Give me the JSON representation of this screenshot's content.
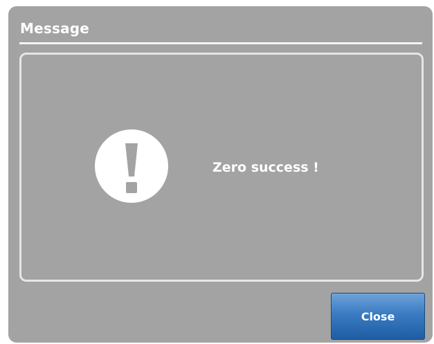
{
  "dialog": {
    "title": "Message",
    "message": "Zero success !",
    "icon": "exclamation-circle-icon",
    "close_label": "Close"
  },
  "colors": {
    "dialog_background": "#a3a3a3",
    "button_accent": "#2f6db3",
    "text": "#ffffff"
  }
}
